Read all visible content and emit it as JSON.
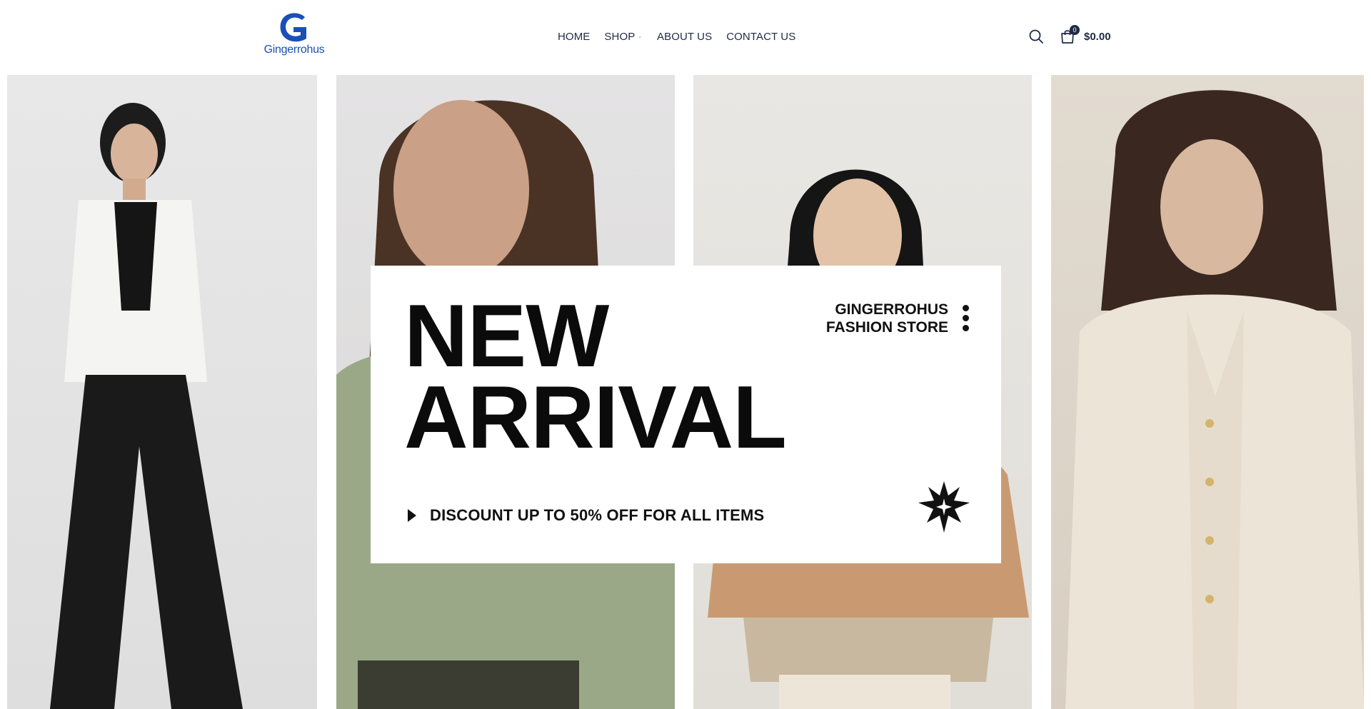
{
  "brand": {
    "logo_text": "Gingerrohus",
    "logo_letter": "G",
    "color": "#1a4fb8"
  },
  "nav": {
    "items": [
      {
        "label": "HOME",
        "has_dropdown": false
      },
      {
        "label": "SHOP",
        "has_dropdown": true
      },
      {
        "label": "ABOUT US",
        "has_dropdown": false
      },
      {
        "label": "CONTACT US",
        "has_dropdown": false
      }
    ]
  },
  "header_tools": {
    "search_icon": "search-icon",
    "cart_icon": "cart-icon",
    "cart_count": "0",
    "cart_total": "$0.00"
  },
  "hero": {
    "title_line1": "NEW",
    "title_line2": "ARRIVAL",
    "brand_line1": "GINGERROHUS",
    "brand_line2": "FASHION STORE",
    "discount": "DISCOUNT UP TO 50% OFF FOR ALL ITEMS",
    "panels": [
      "model-white-cardigan-photo",
      "model-green-sweater-photo",
      "model-camel-jacket-photo",
      "model-cream-cardigan-photo"
    ]
  }
}
